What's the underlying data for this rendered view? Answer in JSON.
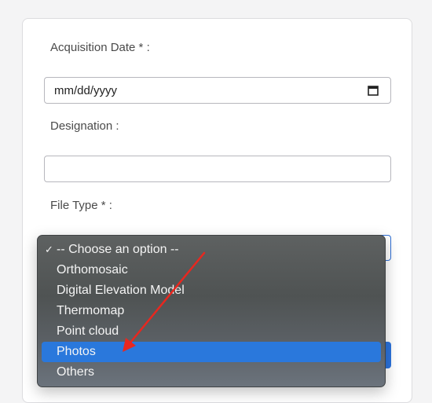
{
  "form": {
    "acquisition_date_label": "Acquisition Date * :",
    "acquisition_date_value": "mm/dd/yyyy",
    "designation_label": "Designation :",
    "designation_value": "",
    "file_type_label": "File Type * :"
  },
  "dropdown": {
    "options": [
      "-- Choose an option --",
      "Orthomosaic",
      "Digital Elevation Model",
      "Thermomap",
      "Point cloud",
      "Photos",
      "Others"
    ],
    "checked_glyph": "✓",
    "checked_option": "-- Choose an option --",
    "highlighted_option": "Photos"
  },
  "colors": {
    "highlight": "#2a78dc",
    "annotation_arrow": "#e8271f",
    "focus_border": "#2f6fd6"
  },
  "icons": {
    "date_picker": "calendar-icon",
    "checkmark": "checkmark-icon",
    "annotation": "red-arrow-annotation"
  }
}
